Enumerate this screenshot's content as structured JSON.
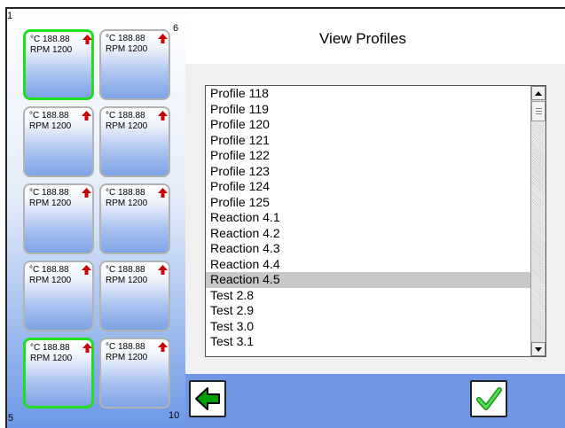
{
  "title": "View Profiles",
  "corner_labels": {
    "top_left": "1",
    "top_right": "6",
    "bottom_left": "5",
    "bottom_right": "10"
  },
  "tiles": [
    {
      "temp": "°C 188.88",
      "rpm": "RPM 1200",
      "active": true
    },
    {
      "temp": "°C 188.88",
      "rpm": "RPM 1200",
      "active": false
    },
    {
      "temp": "°C 188.88",
      "rpm": "RPM 1200",
      "active": false
    },
    {
      "temp": "°C 188.88",
      "rpm": "RPM 1200",
      "active": false
    },
    {
      "temp": "°C 188.88",
      "rpm": "RPM 1200",
      "active": false
    },
    {
      "temp": "°C 188.88",
      "rpm": "RPM 1200",
      "active": false
    },
    {
      "temp": "°C 188.88",
      "rpm": "RPM 1200",
      "active": false
    },
    {
      "temp": "°C 188.88",
      "rpm": "RPM 1200",
      "active": false
    },
    {
      "temp": "°C 188.88",
      "rpm": "RPM 1200",
      "active": true
    },
    {
      "temp": "°C 188.88",
      "rpm": "RPM 1200",
      "active": false
    }
  ],
  "profiles": [
    "Profile 118",
    "Profile 119",
    "Profile 120",
    "Profile 121",
    "Profile 122",
    "Profile 123",
    "Profile 124",
    "Profile 125",
    "Reaction 4.1",
    "Reaction 4.2",
    "Reaction 4.3",
    "Reaction 4.4",
    "Reaction 4.5",
    "Test 2.8",
    "Test 2.9",
    "Test 3.0",
    "Test 3.1"
  ],
  "selected_profile": "Reaction 4.5",
  "icons": {
    "tile_arrow": "red-up-arrow-icon",
    "back": "green-left-arrow-icon",
    "ok": "green-checkmark-icon",
    "scroll_up": "triangle-up-icon",
    "scroll_down": "triangle-down-icon"
  },
  "colors": {
    "active_tile_border": "#22dd22",
    "arrow": "#cc0000",
    "back_arrow": "#00a000",
    "check": "#22bb22",
    "bottom_bar": "#6f97e6",
    "selection": "#c8c8c8"
  }
}
